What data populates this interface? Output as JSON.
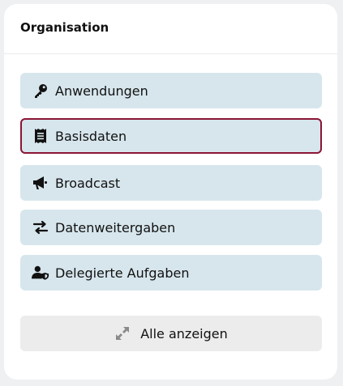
{
  "card": {
    "title": "Organisation"
  },
  "items": [
    {
      "label": "Anwendungen",
      "icon": "key-icon"
    },
    {
      "label": "Basisdaten",
      "icon": "receipt-icon",
      "active": true
    },
    {
      "label": "Broadcast",
      "icon": "megaphone-icon"
    },
    {
      "label": "Datenweitergaben",
      "icon": "arrows-exchange-icon"
    },
    {
      "label": "Delegierte Aufgaben",
      "icon": "user-shield-icon"
    }
  ],
  "show_all": {
    "label": "Alle anzeigen",
    "icon": "expand-icon"
  },
  "colors": {
    "button_bg": "#d7e6ed",
    "active_border": "#8b1535",
    "show_all_bg": "#ececec"
  }
}
